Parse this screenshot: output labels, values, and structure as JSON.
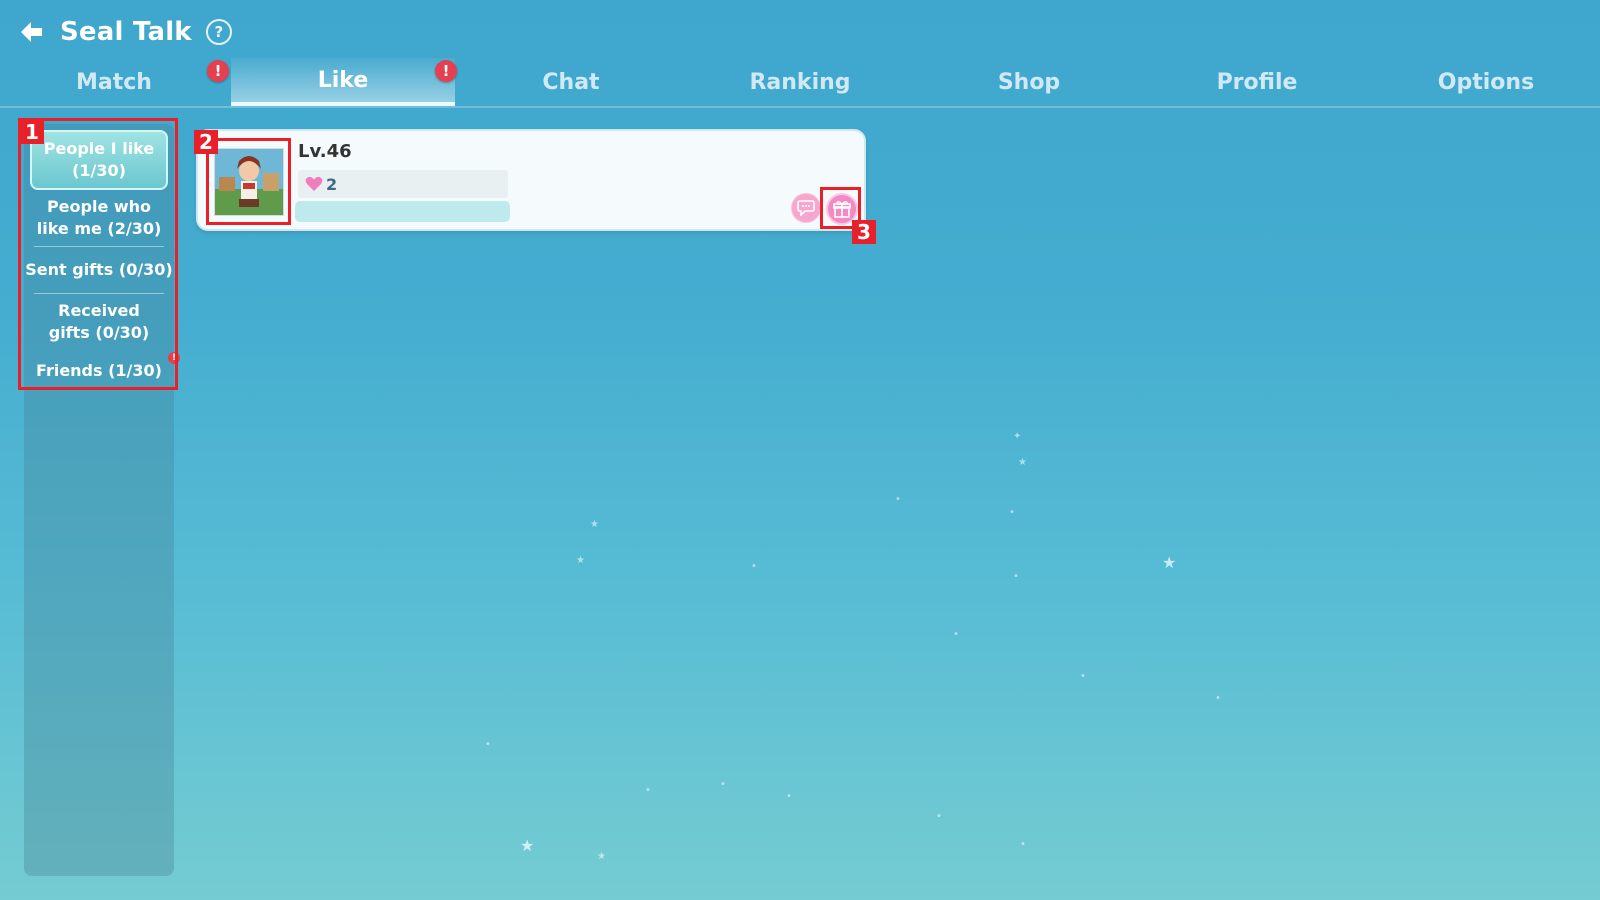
{
  "header": {
    "title": "Seal Talk",
    "help_label": "?"
  },
  "tabs": [
    {
      "label": "Match"
    },
    {
      "label": "Like"
    },
    {
      "label": "Chat"
    },
    {
      "label": "Ranking"
    },
    {
      "label": "Shop"
    },
    {
      "label": "Profile"
    },
    {
      "label": "Options"
    }
  ],
  "badges": {
    "match": "!",
    "like": "!",
    "friends": "!"
  },
  "sidebar": {
    "items": [
      {
        "label": "People I like (1/30)"
      },
      {
        "label": "People who like me (2/30)"
      },
      {
        "label": "Sent gifts (0/30)"
      },
      {
        "label": "Received gifts (0/30)"
      },
      {
        "label": "Friends (1/30)"
      }
    ]
  },
  "markers": [
    "1",
    "2",
    "3"
  ],
  "card": {
    "level": "Lv.46",
    "likes": "2"
  },
  "colors": {
    "badge": "#e5404f",
    "highlight": "#e8202a",
    "gift_button": "#f48ac4",
    "chat_button": "#f7a7cf"
  },
  "icons": [
    "back-arrow-icon",
    "help-icon",
    "heart-icon",
    "chat-bubble-icon",
    "gift-icon"
  ]
}
